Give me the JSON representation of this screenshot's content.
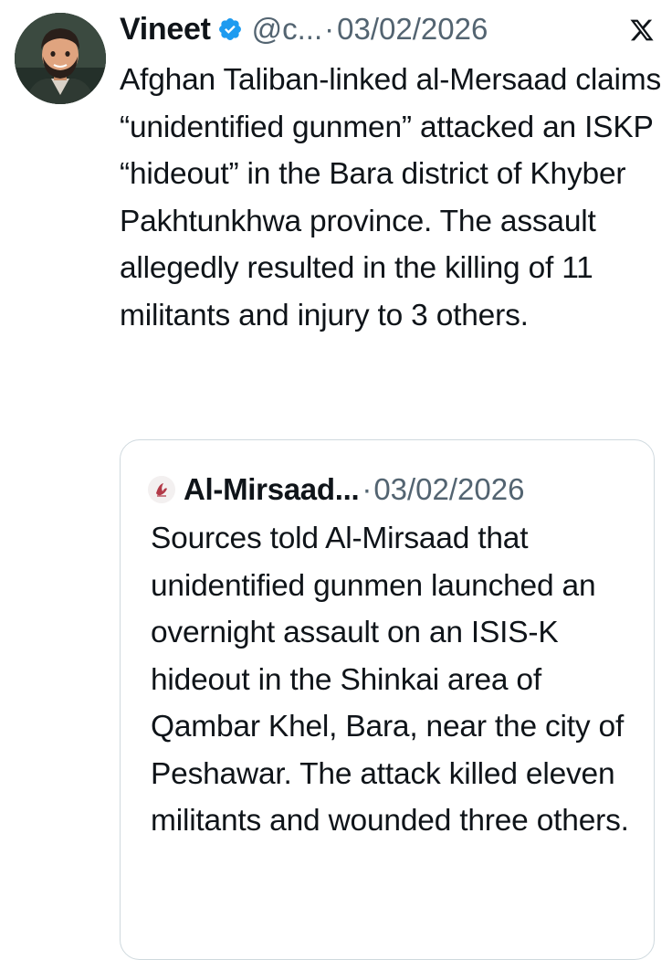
{
  "author": {
    "display_name": "Vineet",
    "handle": "@c...",
    "separator": "·",
    "date": "03/02/2026",
    "verified_color": "#1d9bf0",
    "avatar_icon": "avatar-icon"
  },
  "platform_icon": "x-logo-icon",
  "tweet": {
    "text": "Afghan Taliban-linked al-Mersaad claims “unidentified gunmen” attacked an ISKP “hideout” in the Bara district of Khyber Pakhtunkhwa province. The assault allegedly resulted in the killing of 11 militants and injury to 3 others."
  },
  "quoted": {
    "display_name": "Al-Mirsaad...",
    "separator": "·",
    "date": "03/02/2026",
    "logo_icon": "al-mirsaad-logo-icon",
    "text": "Sources told Al-Mirsaad that unidentified gunmen launched an overnight assault on an ISIS-K hideout in the Shinkai area of Qambar Khel, Bara, near the city of Peshawar. The attack killed eleven militants and wounded three others."
  },
  "colors": {
    "text_primary": "#0f1419",
    "text_secondary": "#536471",
    "border": "#cfd9de",
    "verified": "#1d9bf0"
  }
}
